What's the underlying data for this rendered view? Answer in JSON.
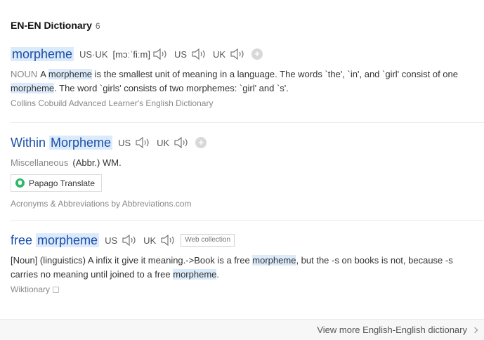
{
  "header": {
    "title": "EN-EN Dictionary",
    "count": "6"
  },
  "entries": [
    {
      "word": "morpheme",
      "pron_uk_us_label": "US·UK",
      "ipa": "[mɔːˈfiːm]",
      "us_label": "US",
      "uk_label": "UK",
      "definition": {
        "pos": "NOUN",
        "parts": [
          "A ",
          "morpheme",
          " is the smallest unit of meaning in a language. The words `the', `in', and `girl' consist of one ",
          "morpheme",
          ". The word `girls' consists of two morphemes: `girl' and `s'."
        ]
      },
      "source": "Collins Cobuild Advanced Learner's English Dictionary"
    },
    {
      "word_plain": "Within ",
      "word_hl": "Morpheme",
      "us_label": "US",
      "uk_label": "UK",
      "misc_pos": "Miscellaneous",
      "misc_text": "(Abbr.) WM.",
      "papago_label": "Papago Translate",
      "source": "Acronyms & Abbreviations by Abbreviations.com"
    },
    {
      "word_plain": "free ",
      "word_hl": "morpheme",
      "us_label": "US",
      "uk_label": "UK",
      "web_tag": "Web collection",
      "definition": {
        "parts": [
          "[Noun] (linguistics) A infix it give it meaning.->Book is a free ",
          "morpheme",
          ", but the -s on books is not, because -s carries no meaning until joined to a free ",
          "morpheme",
          "."
        ]
      },
      "source": "Wiktionary"
    }
  ],
  "footer": {
    "more_label": "View more English-English dictionary"
  },
  "colors": {
    "link": "#1a4ea8",
    "highlight": "#dcebfb",
    "muted": "#888888"
  },
  "icons": [
    "speaker-icon",
    "plus-icon",
    "papago-icon",
    "external-link-icon",
    "chevron-right-icon"
  ]
}
